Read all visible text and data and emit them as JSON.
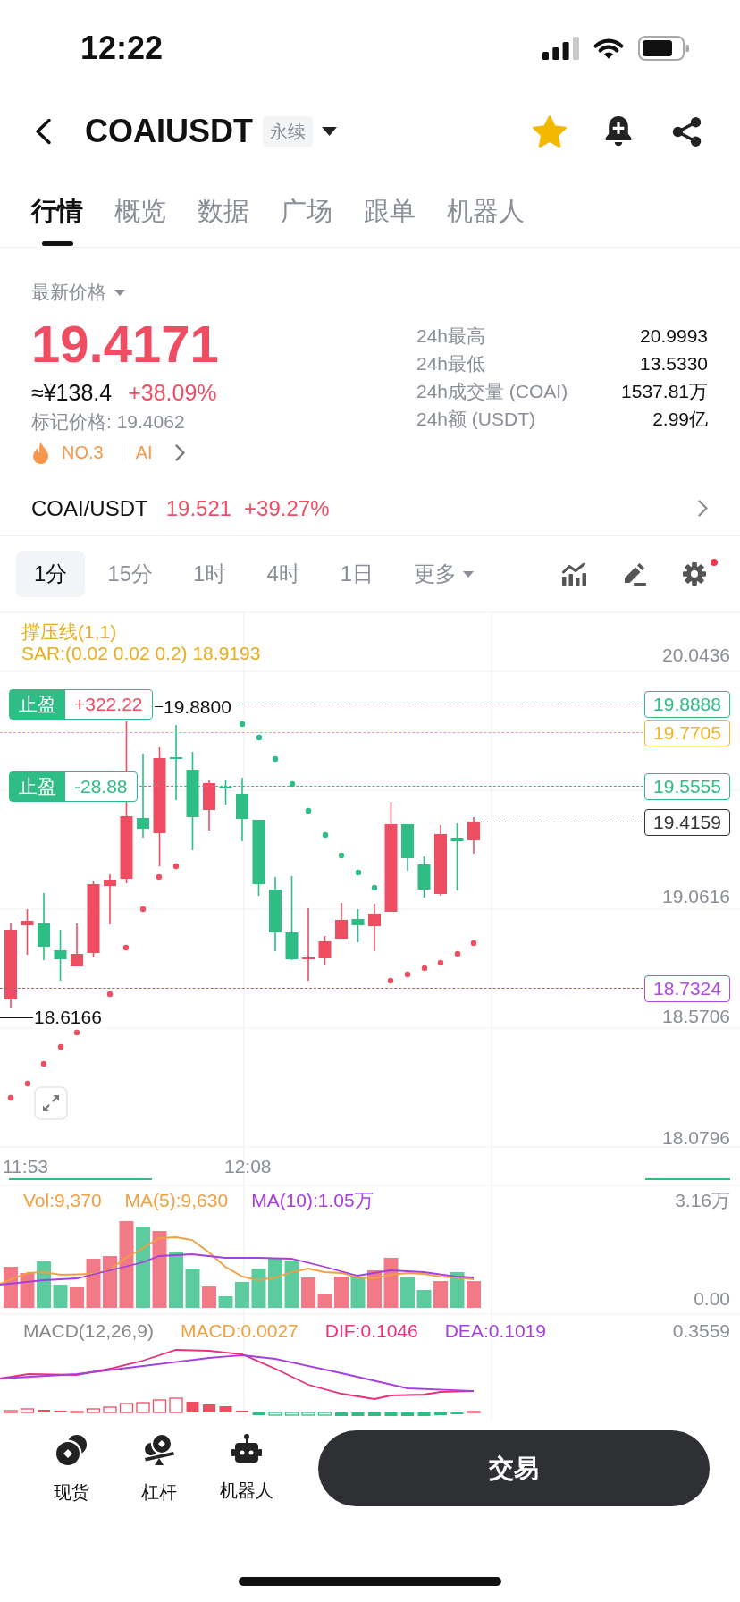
{
  "status_bar": {
    "time": "12:22"
  },
  "header": {
    "symbol": "COAIUSDT",
    "contract_type": "永续",
    "favorite": true
  },
  "tabs": [
    {
      "label": "行情",
      "selected": true
    },
    {
      "label": "概览",
      "selected": false
    },
    {
      "label": "数据",
      "selected": false
    },
    {
      "label": "广场",
      "selected": false
    },
    {
      "label": "跟单",
      "selected": false
    },
    {
      "label": "机器人",
      "selected": false
    }
  ],
  "ticker": {
    "price_label": "最新价格",
    "last_price": "19.4171",
    "fiat_price": "≈¥138.4",
    "change": "+38.09%",
    "mark_price": "标记价格: 19.4062",
    "rank": "NO.3",
    "sector": "AI"
  },
  "stats": [
    {
      "label": "24h最高",
      "value": "20.9993"
    },
    {
      "label": "24h最低",
      "value": "13.5330"
    },
    {
      "label": "24h成交量 (COAI)",
      "value": "1537.81万"
    },
    {
      "label": "24h额 (USDT)",
      "value": "2.99亿"
    }
  ],
  "spot_market": {
    "pair": "COAI/USDT",
    "price": "19.521",
    "change": "+39.27%"
  },
  "intervals": [
    {
      "label": "1分",
      "selected": true,
      "kind": "interval"
    },
    {
      "label": "15分",
      "selected": false,
      "kind": "interval"
    },
    {
      "label": "1时",
      "selected": false,
      "kind": "interval"
    },
    {
      "label": "4时",
      "selected": false,
      "kind": "interval"
    },
    {
      "label": "1日",
      "selected": false,
      "kind": "interval"
    },
    {
      "label": "更多",
      "selected": false,
      "kind": "menu"
    }
  ],
  "chart_settings_badge": true,
  "chart": {
    "indicator_legend": [
      "撑压线(1,1)",
      "SAR:(0.02 0.02 0.2) 18.9193"
    ],
    "price_axis": [
      "20.0436",
      "19.0616",
      "18.5706",
      "18.0796"
    ],
    "price_lines": [
      {
        "value": "19.8888",
        "color": "#2ebd85",
        "order": {
          "label": "止盈",
          "pnl": "+322.22",
          "color": "#ee4d62"
        }
      },
      {
        "value": "19.7705",
        "color": "#f0b429"
      },
      {
        "value": "19.5555",
        "color": "#2ebd85",
        "order": {
          "label": "止盈",
          "pnl": "-28.88",
          "color": "#2ebd85"
        }
      },
      {
        "value": "19.4159",
        "color": "#333333"
      },
      {
        "value": "18.7324",
        "color": "#b04ae6"
      }
    ],
    "high_marker": "19.8800",
    "low_marker": "18.6166",
    "time_axis": [
      "11:53",
      "12:08"
    ]
  },
  "volume": {
    "legend": [
      {
        "text": "Vol:9,370",
        "color": "#f0a040"
      },
      {
        "text": "MA(5):9,630",
        "color": "#f0a040"
      },
      {
        "text": "MA(10):1.05万",
        "color": "#a63ee0"
      }
    ],
    "axis": [
      "3.16万",
      "0.00"
    ]
  },
  "macd": {
    "legend": [
      {
        "text": "MACD(12,26,9)",
        "color": "#888888"
      },
      {
        "text": "MACD:0.0027",
        "color": "#f0a040"
      },
      {
        "text": "DIF:0.1046",
        "color": "#e8317a"
      },
      {
        "text": "DEA:0.1019",
        "color": "#a63ee0"
      }
    ],
    "axis": "0.3559"
  },
  "bottom_nav": [
    {
      "label": "现货"
    },
    {
      "label": "杠杆"
    },
    {
      "label": "机器人"
    }
  ],
  "trade_button": "交易"
}
